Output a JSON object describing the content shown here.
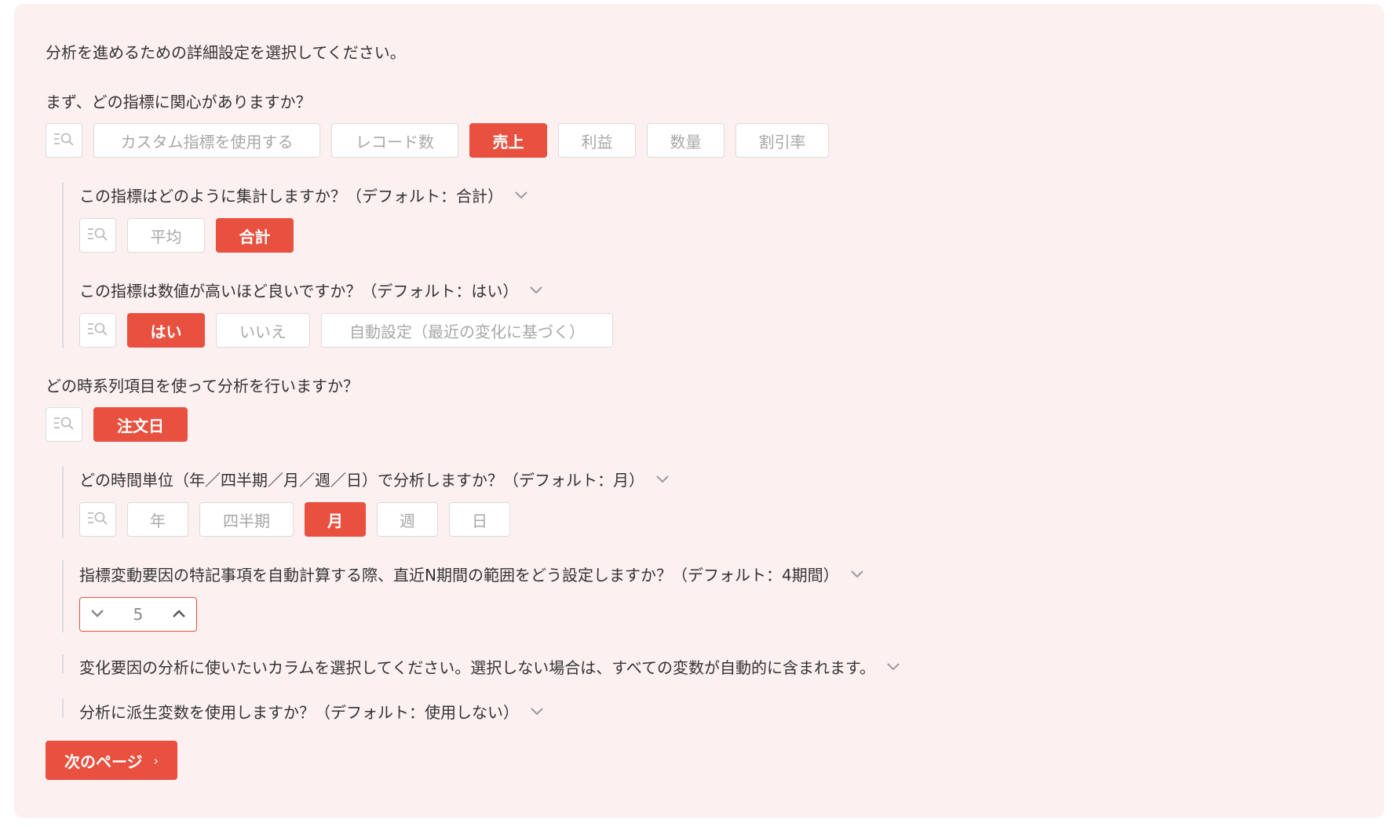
{
  "intro": "分析を進めるための詳細設定を選択してください。",
  "metric": {
    "question": "まず、どの指標に関心がありますか？",
    "options": [
      "カスタム指標を使用する",
      "レコード数",
      "売上",
      "利益",
      "数量",
      "割引率"
    ],
    "selected": "売上"
  },
  "aggregation": {
    "question": "この指標はどのように集計しますか？（デフォルト：合計）",
    "options": [
      "平均",
      "合計"
    ],
    "selected": "合計"
  },
  "higher_better": {
    "question": "この指標は数値が高いほど良いですか？（デフォルト：はい）",
    "options": [
      "はい",
      "いいえ",
      "自動設定（最近の変化に基づく）"
    ],
    "selected": "はい"
  },
  "timeseries": {
    "question": "どの時系列項目を使って分析を行いますか？",
    "options": [
      "注文日"
    ],
    "selected": "注文日"
  },
  "time_unit": {
    "question": "どの時間単位（年／四半期／月／週／日）で分析しますか？（デフォルト：月）",
    "options": [
      "年",
      "四半期",
      "月",
      "週",
      "日"
    ],
    "selected": "月"
  },
  "n_periods": {
    "question": "指標変動要因の特記事項を自動計算する際、直近N期間の範囲をどう設定しますか？（デフォルト：4期間）",
    "value": "5"
  },
  "columns": {
    "question": "変化要因の分析に使いたいカラムを選択してください。選択しない場合は、すべての変数が自動的に含まれます。"
  },
  "derived": {
    "question": "分析に派生変数を使用しますか？（デフォルト：使用しない）"
  },
  "next_button": {
    "label": "次のページ",
    "arrow": "›"
  },
  "icons": {
    "search_list": "search-list-icon",
    "chevron_down": "chevron-down-icon",
    "chevron_up": "chevron-up-icon"
  },
  "colors": {
    "accent": "#e8503f",
    "panel_bg": "#fdf0f0",
    "chip_border": "#dcdcdc",
    "chip_text": "#a8a8a8"
  }
}
